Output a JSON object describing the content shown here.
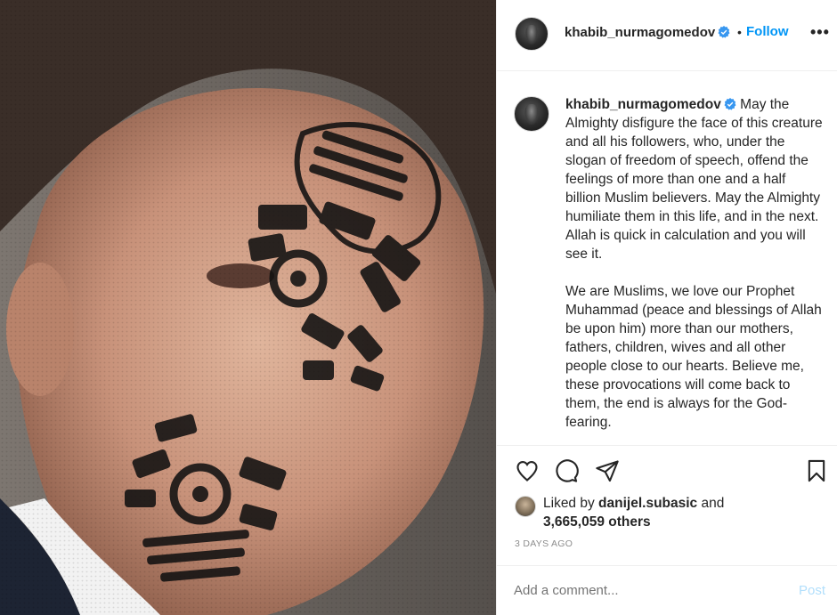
{
  "post": {
    "author": "khabib_nurmagomedov",
    "follow_label": "Follow",
    "dot": "•",
    "more_label": "•••",
    "image_alt": "Portrait photo with boot-print overlay",
    "caption_paragraphs": [
      "May the Almighty disfigure the face of this creature and all his followers, who, under the slogan of freedom of speech, offend the feelings of more than one and a half billion Muslim believers. May the Almighty humiliate them in this life, and in the next. Allah is quick in calculation and you will see it.",
      "We are Muslims, we love our Prophet Muhammad (peace and blessings of Allah be upon him) more than our mothers, fathers, children, wives and all other people close to our hearts. Believe me, these provocations will come back to them, the end is always for the God-fearing."
    ],
    "liked_by_prefix": "Liked by",
    "liked_by_user": "danijel.subasic",
    "liked_by_suffix": "and",
    "others_count": "3,665,059 others",
    "time_ago": "3 DAYS AGO",
    "comment_placeholder": "Add a comment...",
    "post_label": "Post"
  },
  "icons": {
    "like": "heart-icon",
    "comment": "comment-bubble-icon",
    "share": "paper-plane-icon",
    "save": "bookmark-icon",
    "verified": "verified-badge-icon",
    "more": "more-options-icon"
  },
  "colors": {
    "accent": "#0095f6",
    "verified": "#3897f0",
    "post_disabled": "#b2dffc",
    "muted": "#8e8e8e",
    "text": "#262626"
  }
}
